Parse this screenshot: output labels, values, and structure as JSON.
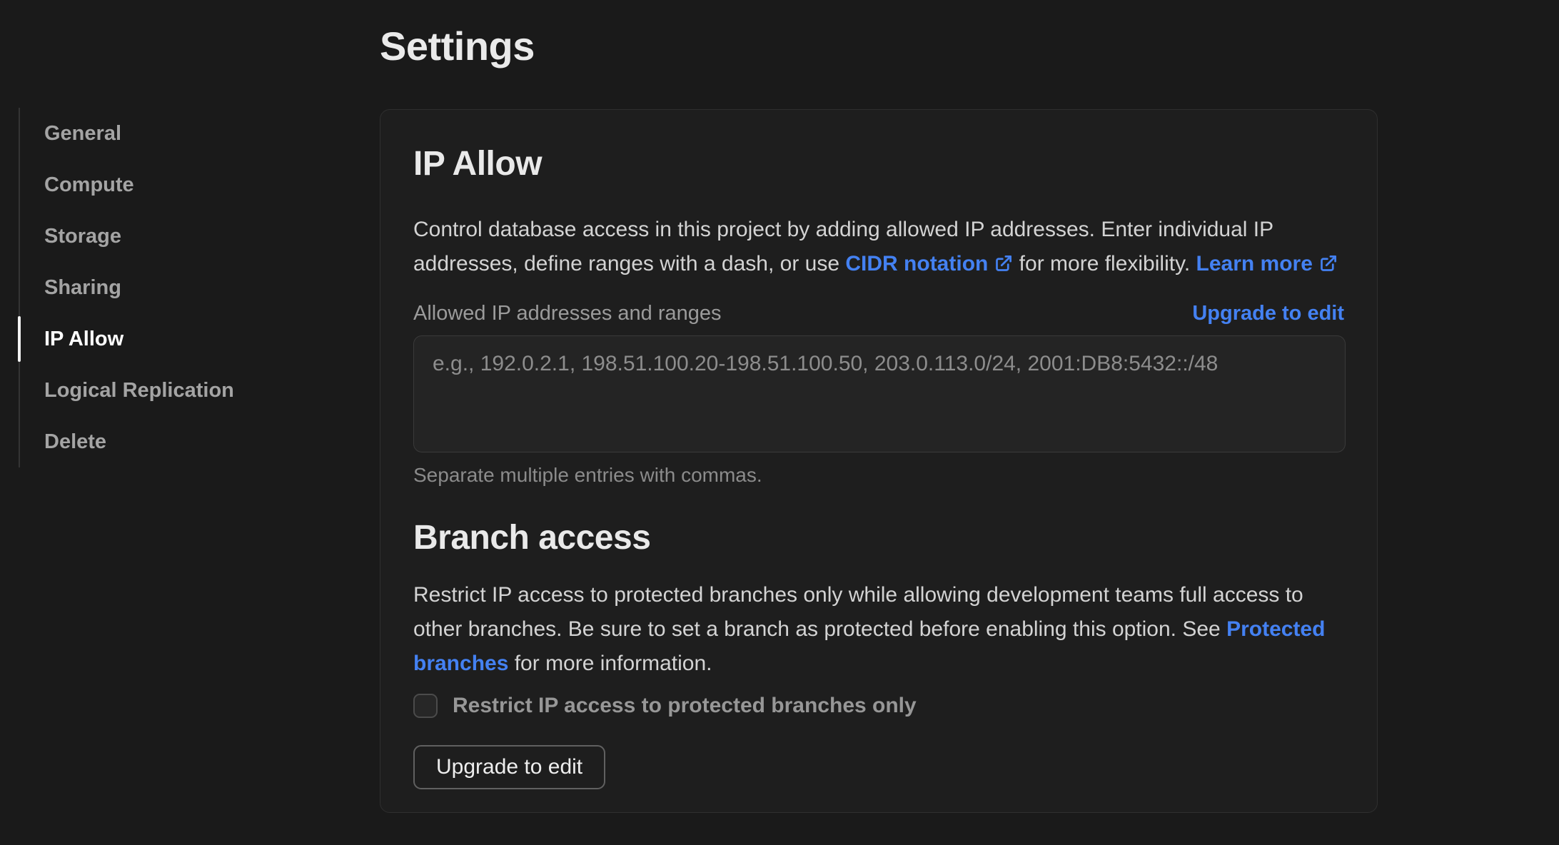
{
  "page": {
    "title": "Settings"
  },
  "colors": {
    "page_background": "#1a1a1a",
    "card_background": "#1e1e1e",
    "card_border": "#2f2f2f",
    "accent_link_blue": "#4481f2",
    "active_nav_indicator": "#ffffff",
    "muted_text": "#9b9b9b"
  },
  "icons": {
    "external_link": "external-link-icon"
  },
  "sidebar": {
    "items": [
      {
        "label": "General",
        "active": false
      },
      {
        "label": "Compute",
        "active": false
      },
      {
        "label": "Storage",
        "active": false
      },
      {
        "label": "Sharing",
        "active": false
      },
      {
        "label": "IP Allow",
        "active": true
      },
      {
        "label": "Logical Replication",
        "active": false
      },
      {
        "label": "Delete",
        "active": false
      }
    ]
  },
  "ip_allow": {
    "heading": "IP Allow",
    "description_part1": "Control database access in this project by adding allowed IP addresses. Enter individual IP addresses, define ranges with a dash, or use ",
    "cidr_link_label": "CIDR notation",
    "description_part2": " for more flexibility. ",
    "learn_more_link_label": "Learn more",
    "field_label": "Allowed IP addresses and ranges",
    "upgrade_link_label": "Upgrade to edit",
    "textarea_value": "",
    "textarea_placeholder": "e.g., 192.0.2.1, 198.51.100.20-198.51.100.50, 203.0.113.0/24, 2001:DB8:5432::/48",
    "helper_text": "Separate multiple entries with commas."
  },
  "branch_access": {
    "heading": "Branch access",
    "description_part1": "Restrict IP access to protected branches only while allowing development teams full access to other branches. Be sure to set a branch as protected before enabling this option. See ",
    "protected_branches_link_label": "Protected branches",
    "description_part2": " for more information.",
    "checkbox_label": "Restrict IP access to protected branches only",
    "checkbox_checked": false,
    "upgrade_button_label": "Upgrade to edit"
  }
}
